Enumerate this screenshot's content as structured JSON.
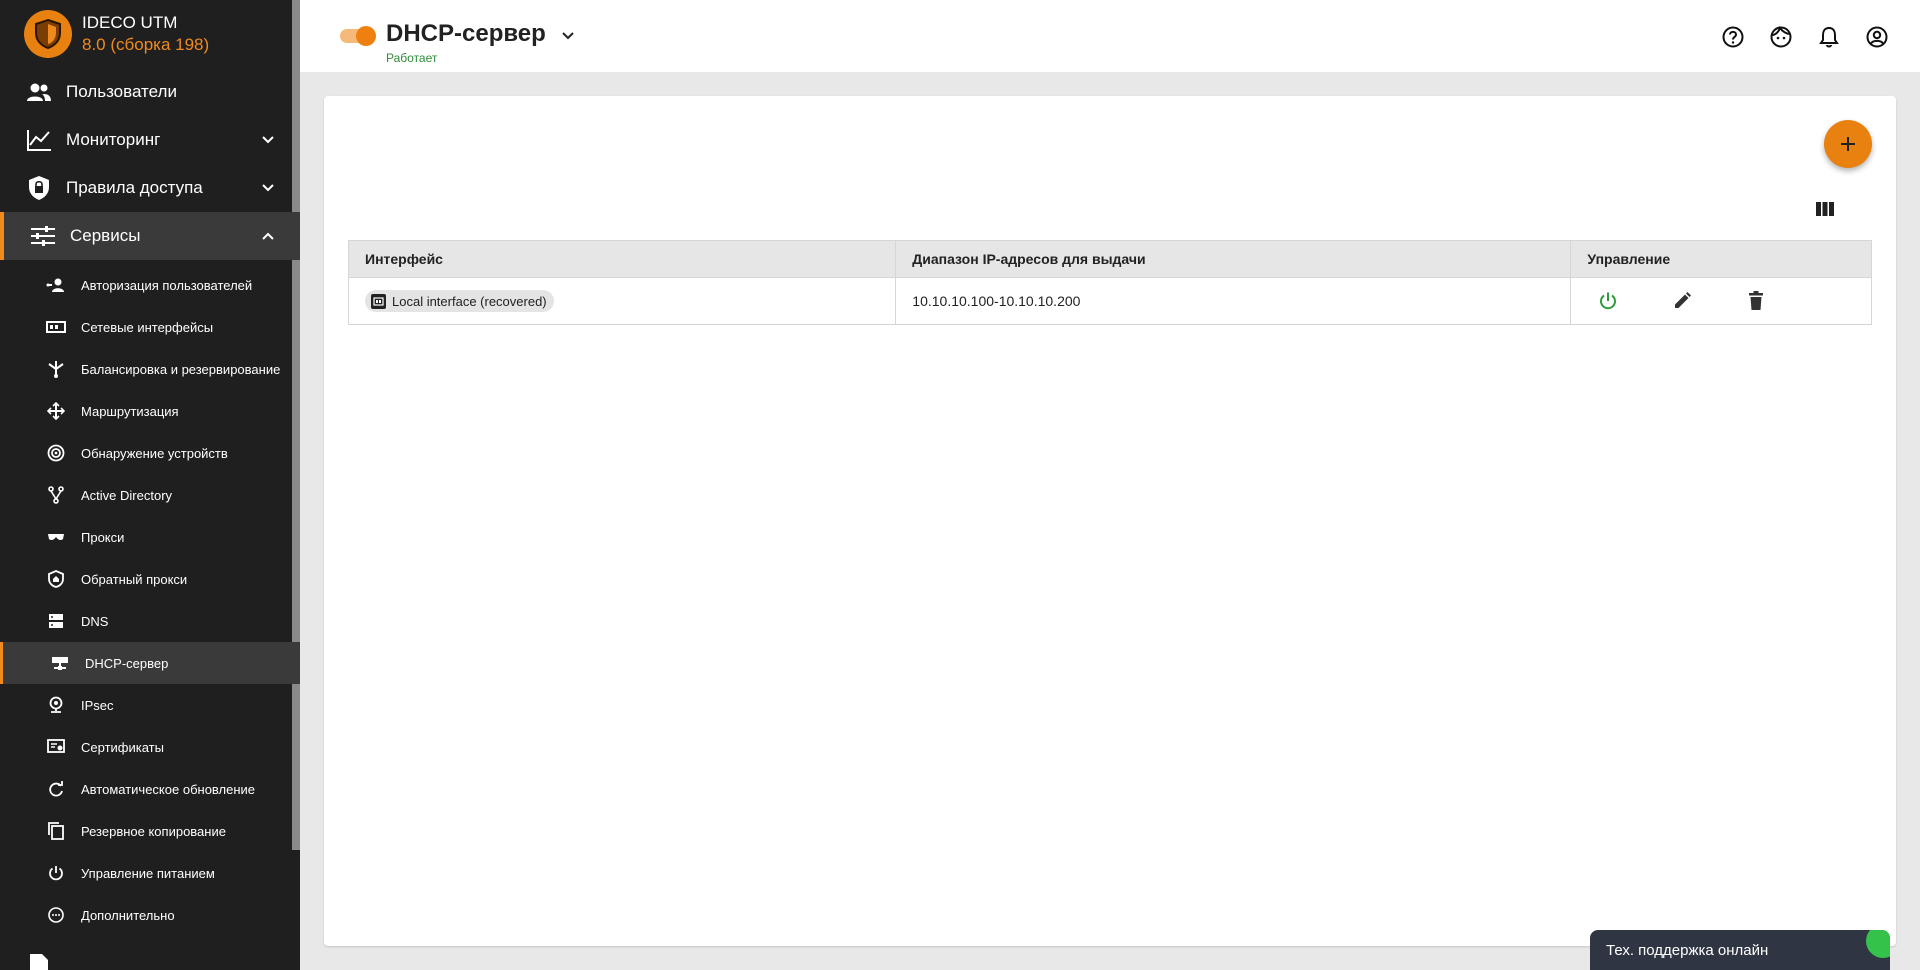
{
  "brand": {
    "name": "IDECO UTM",
    "version": "8.0 (сборка 198)",
    "accent": "#e8810f"
  },
  "nav": {
    "users": "Пользователи",
    "monitoring": "Мониторинг",
    "access_rules": "Правила доступа",
    "services": "Сервисы"
  },
  "services_menu": [
    {
      "label": "Авторизация пользователей",
      "icon": "user-auth-icon"
    },
    {
      "label": "Сетевые интерфейсы",
      "icon": "network-interface-icon"
    },
    {
      "label": "Балансировка и резервирование",
      "icon": "balancing-icon"
    },
    {
      "label": "Маршрутизация",
      "icon": "routing-icon"
    },
    {
      "label": "Обнаружение устройств",
      "icon": "radar-icon"
    },
    {
      "label": "Active Directory",
      "icon": "directory-icon"
    },
    {
      "label": "Прокси",
      "icon": "proxy-icon"
    },
    {
      "label": "Обратный прокси",
      "icon": "reverse-proxy-icon"
    },
    {
      "label": "DNS",
      "icon": "dns-icon"
    },
    {
      "label": "DHCP-сервер",
      "icon": "dhcp-icon"
    },
    {
      "label": "IPsec",
      "icon": "ipsec-icon"
    },
    {
      "label": "Сертификаты",
      "icon": "certificate-icon"
    },
    {
      "label": "Автоматическое обновление",
      "icon": "refresh-icon"
    },
    {
      "label": "Резервное копирование",
      "icon": "copy-icon"
    },
    {
      "label": "Управление питанием",
      "icon": "power-icon"
    },
    {
      "label": "Дополнительно",
      "icon": "more-icon"
    }
  ],
  "header": {
    "title": "DHCP-сервер",
    "status": "Работает",
    "service_enabled": true
  },
  "table": {
    "columns": [
      "Интерфейс",
      "Диапазон IP-адресов для выдачи",
      "Управление"
    ],
    "rows": [
      {
        "interface": "Local interface (recovered)",
        "range": "10.10.10.100-10.10.10.200"
      }
    ]
  },
  "support": {
    "label": "Тех. поддержка онлайн"
  }
}
